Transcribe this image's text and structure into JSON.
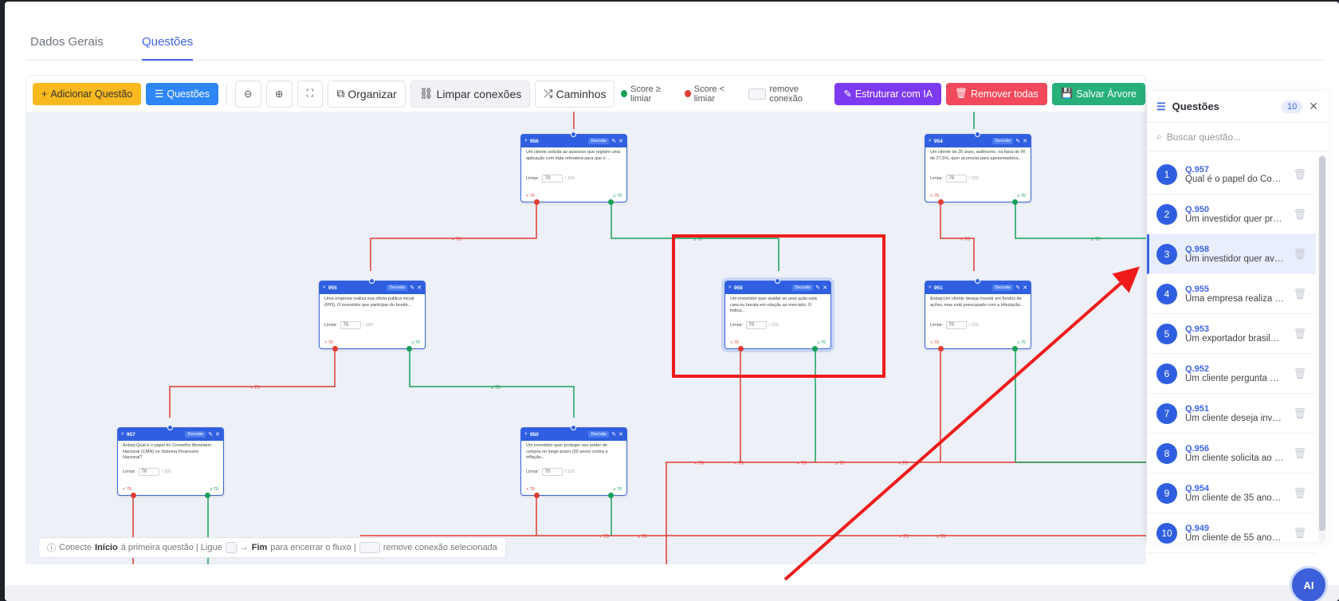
{
  "tabs": [
    {
      "label": "Dados Gerais"
    },
    {
      "label": "Questões"
    }
  ],
  "toolbar": {
    "add_question": "Adicionar Questão",
    "questions": "Questões",
    "organize": "Organizar",
    "clear_connections": "Limpar conexões",
    "paths": "Caminhos",
    "legend_high": "Score ≥ limiar",
    "legend_low": "Score < limiar",
    "legend_remove": "remove conexão",
    "structure_ai": "Estruturar com IA",
    "remove_all": "Remover todas",
    "save_tree": "Salvar Árvore"
  },
  "nodes": [
    {
      "id": "956",
      "tag": "Decisão",
      "text": "Um cliente solicita ao assessor que registre uma aplicação com data retroativa para que o ...",
      "limiar_label": "Limiar:",
      "limiar": "70",
      "of": "/ 100",
      "lo": "< 70",
      "hi": "≥ 70"
    },
    {
      "id": "954",
      "tag": "Decisão",
      "text": "Um cliente de 35 anos, autônomo, na faixa do IR de 27,5%, quer acumular para aposentadoria...",
      "limiar_label": "Limiar:",
      "limiar": "70",
      "of": "/ 100",
      "lo": "< 70",
      "hi": "≥ 70"
    },
    {
      "id": "955",
      "tag": "Decisão",
      "text": "Uma empresa realiza sua oferta pública inicial (IPO). O investidor que participar do bookb...",
      "limiar_label": "Limiar:",
      "limiar": "70",
      "of": "/ 100",
      "lo": "< 70",
      "hi": "≥ 70"
    },
    {
      "id": "958",
      "tag": "Decisão",
      "text": "Um investidor quer avaliar se uma ação está cara ou barata em relação ao mercado. O indica...",
      "limiar_label": "Limiar:",
      "limiar": "70",
      "of": "/ 100",
      "lo": "< 70",
      "hi": "≥ 70"
    },
    {
      "id": "951",
      "tag": "Decisão",
      "text": "&nbsp;Um cliente deseja investir em fundos de ações, mas está preocupado com a tributação...",
      "limiar_label": "Limiar:",
      "limiar": "70",
      "of": "/ 100",
      "lo": "< 70",
      "hi": "≥ 70"
    },
    {
      "id": "957",
      "tag": "Decisão",
      "text": "&nbsp;Qual é o papel do Conselho Monetário Nacional (CMN) no Sistema Financeiro Nacional?",
      "limiar_label": "Limiar:",
      "limiar": "70",
      "of": "/ 100",
      "lo": "< 70",
      "hi": "≥ 70"
    },
    {
      "id": "950",
      "tag": "Decisão",
      "text": "Um investidor quer proteger seu poder de compra no longo prazo (20 anos) contra a inflação...",
      "limiar_label": "Limiar:",
      "limiar": "70",
      "of": "/ 100",
      "lo": "< 70",
      "hi": "≥ 70"
    }
  ],
  "edge_labels": {
    "lo": "< 70",
    "hi": "≥ 70"
  },
  "hint": {
    "pre": "Conecte",
    "start": "Início",
    "mid": "à primeira questão  |  Ligue",
    "arrow": "→",
    "end": "Fim",
    "post": "para encerrar o fluxo  |",
    "tail": "remove conexão selecionada"
  },
  "panel": {
    "title": "Questões",
    "count": "10",
    "search_placeholder": "Buscar questão...",
    "items": [
      {
        "num": "1",
        "id": "Q.957",
        "desc": "Qual é o papel do Cons..."
      },
      {
        "num": "2",
        "id": "Q.950",
        "desc": "Um investidor quer prot..."
      },
      {
        "num": "3",
        "id": "Q.958",
        "desc": "Um investidor quer aval..."
      },
      {
        "num": "4",
        "id": "Q.955",
        "desc": "Uma empresa realiza s..."
      },
      {
        "num": "5",
        "id": "Q.953",
        "desc": "Um exportador brasileir..."
      },
      {
        "num": "6",
        "id": "Q.952",
        "desc": "Um cliente pergunta qu..."
      },
      {
        "num": "7",
        "id": "Q.951",
        "desc": "Um cliente deseja inves..."
      },
      {
        "num": "8",
        "id": "Q.956",
        "desc": "Um cliente solicita ao a..."
      },
      {
        "num": "9",
        "id": "Q.954",
        "desc": "Um cliente de 35 anos, ..."
      },
      {
        "num": "10",
        "id": "Q.949",
        "desc": "Um cliente de 55 anos, ..."
      }
    ]
  },
  "fab_label": "AI",
  "colors": {
    "accent": "#3d64e6",
    "low": "#e03c31",
    "high": "#18a058",
    "highlight": "#ef1b1b"
  }
}
